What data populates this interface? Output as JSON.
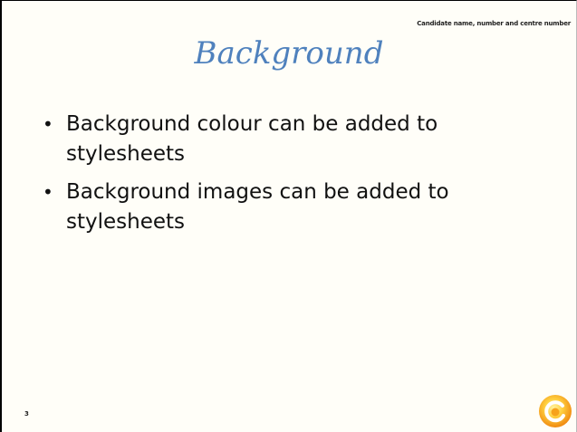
{
  "slide": {
    "header_note": "Candidate name, number and centre number",
    "title": "Background",
    "bullets": [
      {
        "text": "Background colour can be added to stylesheets"
      },
      {
        "text": "Background images can be added to stylesheets"
      }
    ],
    "slide_number": "3",
    "logo_icon": "orange-sun-swirl-logo-icon"
  },
  "colors": {
    "title": "#4f81bd",
    "background": "#fffef8",
    "logo_outer": "#f7a21b",
    "logo_inner": "#ffe066"
  }
}
